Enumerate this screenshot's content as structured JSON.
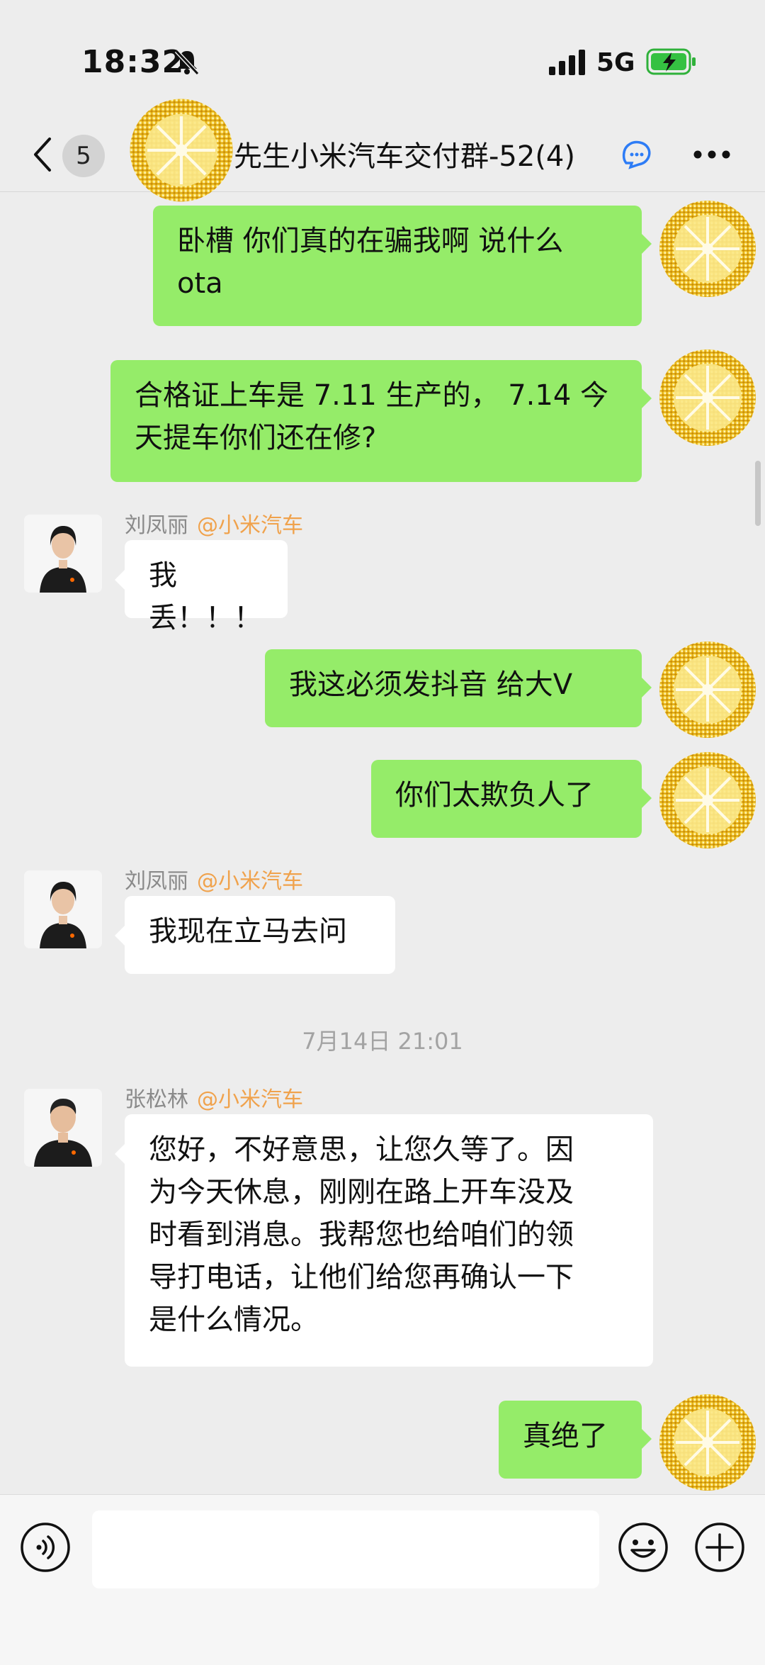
{
  "status_bar": {
    "time": "18:32",
    "network": "5G",
    "icons": [
      "mute-icon",
      "signal-icon",
      "battery-charging-icon"
    ]
  },
  "nav": {
    "unread_count": "5",
    "title": "先生小米汽车交付群-52(4)",
    "icons": [
      "back-icon",
      "group-members-icon",
      "more-icon"
    ]
  },
  "messages": [
    {
      "from": "me",
      "lines": [
        "卧槽 你们真的在骗我啊  说什么",
        "ota"
      ]
    },
    {
      "from": "me",
      "lines": [
        "合格证上车是 7.11 生产的， 7.14 今",
        "天提车你们还在修?"
      ]
    },
    {
      "from": "other",
      "name": "刘凤丽",
      "org": "@小米汽车",
      "lines": [
        "我丢！！！"
      ]
    },
    {
      "from": "me",
      "lines": [
        "我这必须发抖音 给大V"
      ]
    },
    {
      "from": "me",
      "lines": [
        "你们太欺负人了"
      ]
    },
    {
      "from": "other",
      "name": "刘凤丽",
      "org": "@小米汽车",
      "lines": [
        "我现在立马去问"
      ]
    },
    {
      "from": "other",
      "name": "张松林",
      "org": "@小米汽车",
      "lines": [
        "您好，不好意思，让您久等了。因",
        "为今天休息，刚刚在路上开车没及",
        "时看到消息。我帮您也给咱们的领",
        "导打电话，让他们给您再确认一下",
        "是什么情况。"
      ]
    },
    {
      "from": "me",
      "lines": [
        "真绝了"
      ]
    }
  ],
  "timestamp": "7月14日 21:01",
  "input_bar": {
    "placeholder": "",
    "icons": [
      "voice-icon",
      "emoji-icon",
      "plus-icon"
    ]
  },
  "colors": {
    "background": "#ededed",
    "my_bubble": "#95ec69",
    "other_bubble": "#ffffff",
    "org_tag": "#f0a24c"
  }
}
